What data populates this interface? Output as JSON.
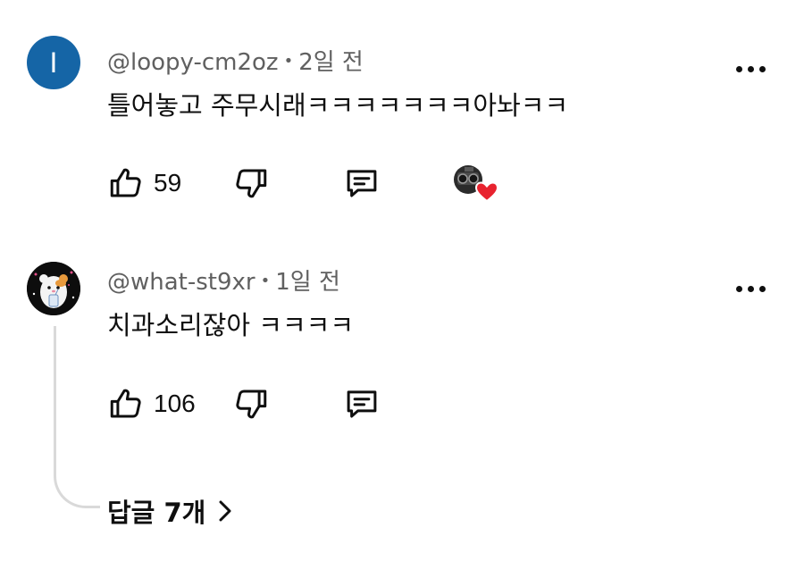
{
  "comments": [
    {
      "avatar_letter": "I",
      "avatar_color": "#1565a6",
      "author": "@loopy-cm2oz",
      "time": "2일 전",
      "text": "틀어놓고 주무시래ㅋㅋㅋㅋㅋㅋㅋ아놔ㅋㅋ",
      "likes": "59",
      "creator_heart": true
    },
    {
      "avatar_icon": "hamster-avatar-icon",
      "author": "@what-st9xr",
      "time": "1일 전",
      "text": "치과소리잖아 ㅋㅋㅋㅋ",
      "likes": "106"
    }
  ],
  "replies_label": "답글 7개",
  "colors": {
    "text_primary": "#0f0f0f",
    "text_secondary": "#606060",
    "heart": "#e8232f",
    "thread_line": "#d9d9d9"
  }
}
